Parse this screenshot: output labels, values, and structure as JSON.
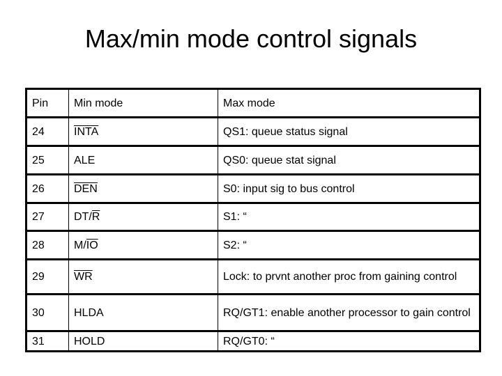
{
  "title": "Max/min mode control signals",
  "table": {
    "headers": [
      "Pin",
      "Min mode",
      "Max mode"
    ],
    "rows": [
      {
        "pin": "24",
        "min_mode": {
          "pre": "",
          "bar": "INTA",
          "post": ""
        },
        "min_mode_active_low": true,
        "max_mode": "QS1: queue status signal"
      },
      {
        "pin": "25",
        "min_mode": {
          "pre": "ALE",
          "bar": "",
          "post": ""
        },
        "min_mode_active_low": false,
        "max_mode": "QS0: queue stat signal"
      },
      {
        "pin": "26",
        "min_mode": {
          "pre": "",
          "bar": "DEN",
          "post": ""
        },
        "min_mode_active_low": true,
        "max_mode": "S0: input sig to bus control"
      },
      {
        "pin": "27",
        "min_mode": {
          "pre": "DT/",
          "bar": "R",
          "post": ""
        },
        "min_mode_active_low": true,
        "max_mode": "S1:  “"
      },
      {
        "pin": "28",
        "min_mode": {
          "pre": "M/",
          "bar": "IO",
          "post": ""
        },
        "min_mode_active_low": true,
        "max_mode": "S2: “"
      },
      {
        "pin": "29",
        "min_mode": {
          "pre": "",
          "bar": "WR",
          "post": ""
        },
        "min_mode_active_low": true,
        "max_mode": "Lock: to prvnt another proc from gaining control"
      },
      {
        "pin": "30",
        "min_mode": {
          "pre": "HLDA",
          "bar": "",
          "post": ""
        },
        "min_mode_active_low": false,
        "max_mode": "RQ/GT1: enable another processor to gain control"
      },
      {
        "pin": "31",
        "min_mode": {
          "pre": "HOLD",
          "bar": "",
          "post": ""
        },
        "min_mode_active_low": false,
        "max_mode": "RQ/GT0: “"
      }
    ]
  }
}
